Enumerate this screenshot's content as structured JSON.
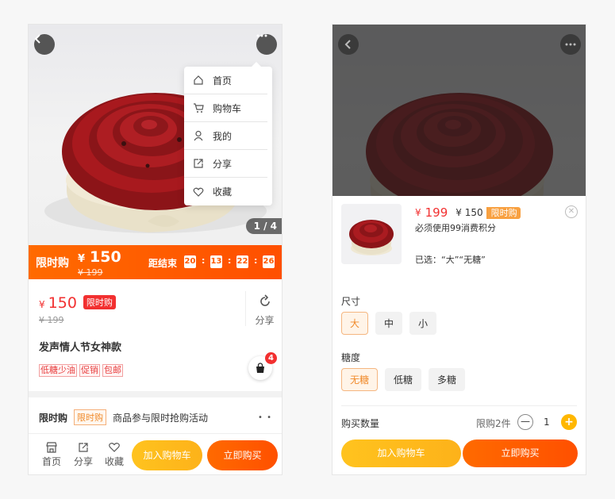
{
  "left_screen": {
    "image_counter": "1 / 4",
    "menu": [
      {
        "label": "首页",
        "icon": "home-icon"
      },
      {
        "label": "购物车",
        "icon": "cart-icon"
      },
      {
        "label": "我的",
        "icon": "user-icon"
      },
      {
        "label": "分享",
        "icon": "share-icon"
      },
      {
        "label": "收藏",
        "icon": "heart-icon"
      }
    ],
    "flash": {
      "tag": "限时购",
      "currency": "¥",
      "price": "150",
      "old_price": "¥ 199",
      "countdown_label": "距结束",
      "countdown": [
        "20",
        "13",
        "22",
        "26"
      ]
    },
    "price_card": {
      "currency": "¥",
      "price": "150",
      "badge": "限时购",
      "old_price": "¥ 199",
      "share_label": "分享"
    },
    "product_title": "发声情人节女神款",
    "tags": [
      "低糖少油",
      "促销",
      "包邮"
    ],
    "cart_count": "4",
    "promo": {
      "label": "限时购",
      "tag": "限时购",
      "desc": "商品参与限时抢购活动"
    },
    "bottom_nav": [
      {
        "label": "首页",
        "icon": "home-icon"
      },
      {
        "label": "分享",
        "icon": "share-icon"
      },
      {
        "label": "收藏",
        "icon": "heart-icon"
      }
    ],
    "add_cart_label": "加入购物车",
    "buy_now_label": "立即购买"
  },
  "right_screen": {
    "sku": {
      "currency": "¥",
      "price": "199",
      "old_price": "¥ 150",
      "badge": "限时购",
      "points_note": "必须使用99消费积分",
      "selected_note": "已选：“大”“无糖”"
    },
    "size": {
      "label": "尺寸",
      "options": [
        "大",
        "中",
        "小"
      ],
      "selected": "大"
    },
    "sugar": {
      "label": "糖度",
      "options": [
        "无糖",
        "低糖",
        "多糖"
      ],
      "selected": "无糖"
    },
    "quantity": {
      "label": "购买数量",
      "limit": "限购2件",
      "value": "1"
    },
    "add_cart_label": "加入购物车",
    "buy_now_label": "立即购买"
  },
  "colors": {
    "accent_orange": "#ff5a00",
    "accent_yellow": "#ffb700",
    "price_red": "#f23030"
  }
}
